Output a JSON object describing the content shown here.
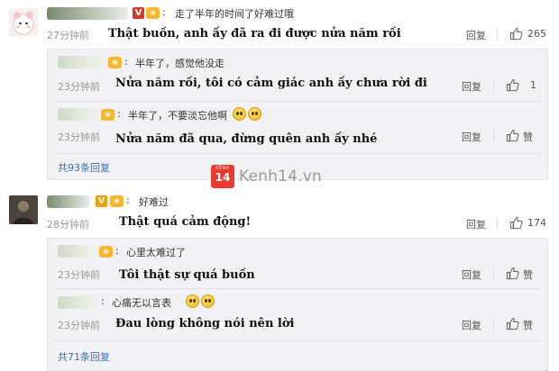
{
  "comments": [
    {
      "chinese": "走了半年的时间了好难过哦",
      "time": "27分钟前",
      "vietnamese": "Thật buồn, anh ấy đã ra đi được nửa năm rồi",
      "reply_label": "回复",
      "likes": "265",
      "replies": [
        {
          "chinese": "半年了，感觉他没走",
          "time": "23分钟前",
          "vietnamese": "Nửa năm rồi, tôi có cảm giác anh ấy chưa rời đi",
          "reply_label": "回复",
          "likes": "1"
        },
        {
          "chinese": "半年了，不要淡忘他啊",
          "time": "23分钟前",
          "vietnamese": "Nửa năm đã qua, đừng quên anh ấy nhé",
          "reply_label": "回复",
          "likes": "赞"
        }
      ],
      "more_replies": "共93条回复"
    },
    {
      "chinese": "好难过",
      "time": "28分钟前",
      "vietnamese": "Thật quá cảm động!",
      "reply_label": "回复",
      "likes": "174",
      "replies": [
        {
          "chinese": "心里太难过了",
          "time": "23分钟前",
          "vietnamese": "Tôi thật sự quá buồn",
          "reply_label": "回复",
          "likes": "赞"
        },
        {
          "chinese": "心痛无以言表",
          "time": "23分钟前",
          "vietnamese": "Đau lòng không nói nên lời",
          "reply_label": "回复",
          "likes": "赞"
        }
      ],
      "more_replies": "共71条回复"
    }
  ],
  "watermark": {
    "logo_top": "KÊNH",
    "logo_number": "14",
    "text": "Kenh14.vn"
  },
  "icons": {
    "thumb": "thumbs-up-icon",
    "emoji": "sad-face-emoji-icon",
    "badge": "verified-v-icon"
  },
  "colors": {
    "link": "#3b6fb6",
    "time": "#999999",
    "panel": "#f2f2f5"
  }
}
